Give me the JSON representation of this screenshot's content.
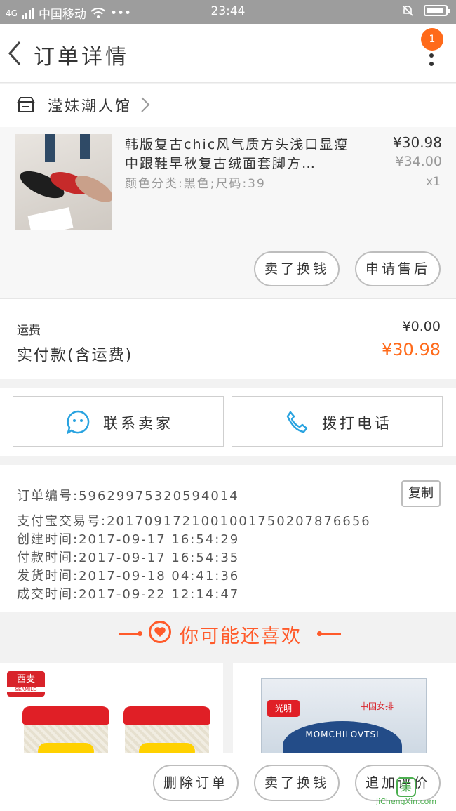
{
  "status_bar": {
    "signal_text": "4G",
    "carrier": "中国移动",
    "dots": "•••",
    "time": "23:44"
  },
  "nav": {
    "title": "订单详情",
    "badge_count": "1",
    "accent": "#ff6a1a"
  },
  "shop": {
    "name": "滢妹潮人馆"
  },
  "item": {
    "title": "韩版复古chic风气质方头浅口显瘦中跟鞋早秋复古绒面套脚方…",
    "spec": "颜色分类:黑色;尺码:39",
    "price": "¥30.98",
    "original_price": "¥34.00",
    "quantity": "x1",
    "actions": [
      "卖了换钱",
      "申请售后"
    ]
  },
  "fees": {
    "shipping_label": "运费",
    "shipping_value": "¥0.00",
    "paid_label": "实付款(含运费)",
    "paid_value": "¥30.98"
  },
  "contact": {
    "seller": "联系卖家",
    "phone": "拨打电话"
  },
  "order_info": {
    "order_no": "订单编号:59629975320594014",
    "alipay_no": "支付宝交易号:2017091721001001750207876656",
    "created": "创建时间:2017-09-17 16:54:29",
    "paid": "付款时间:2017-09-17 16:54:35",
    "shipped": "发货时间:2017-09-18 04:41:36",
    "completed": "成交时间:2017-09-22 12:14:47",
    "copy_label": "复制"
  },
  "recommend": {
    "title": "你可能还喜欢",
    "products": [
      {
        "brand": "西麦",
        "brand_sub": "SEAMILD"
      },
      {
        "brand": "光明",
        "brand_sub": "中国女排",
        "product": "MOMCHILOVTSI"
      }
    ]
  },
  "bottom_bar": {
    "buttons": [
      "删除订单",
      "卖了换钱",
      "追加评价"
    ],
    "watermark": "JiChengXin.com"
  }
}
